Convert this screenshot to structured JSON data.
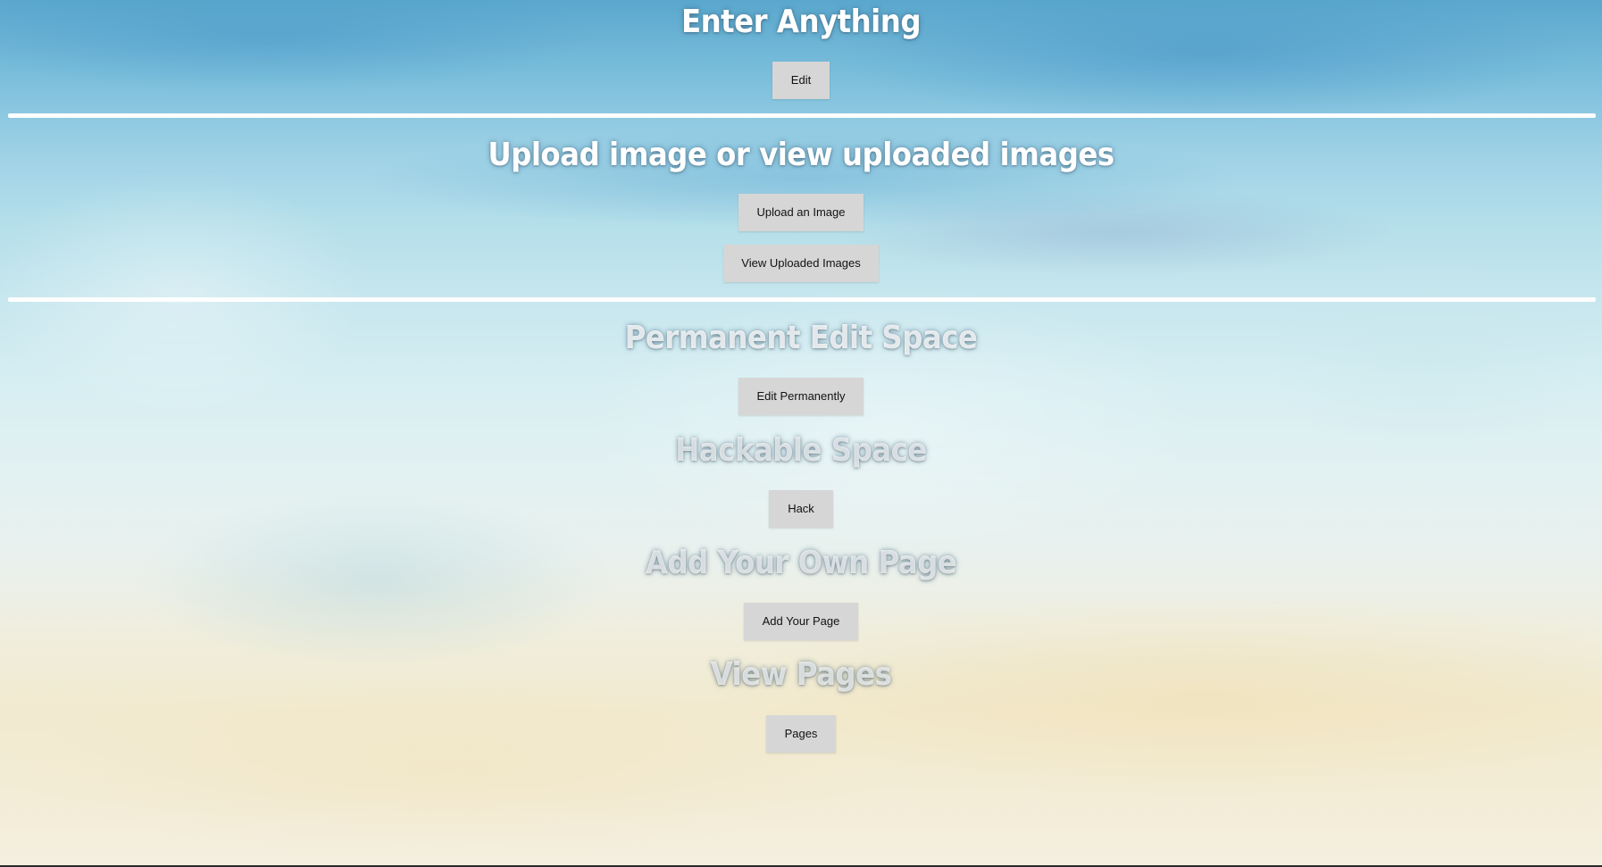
{
  "sections": {
    "enter_anything": {
      "title": "Enter Anything",
      "edit_button": "Edit"
    },
    "upload": {
      "title": "Upload image or view uploaded images",
      "upload_button": "Upload an Image",
      "view_button": "View Uploaded Images"
    },
    "permanent": {
      "title": "Permanent Edit Space",
      "edit_permanently_button": "Edit Permanently"
    },
    "hackable": {
      "title": "Hackable Space",
      "hack_button": "Hack"
    },
    "add_page": {
      "title": "Add Your Own Page",
      "add_button": "Add Your Page"
    },
    "view_pages": {
      "title": "View Pages",
      "pages_button": "Pages"
    }
  },
  "colors": {
    "button_background": "#d6d6d6",
    "button_text": "#111111",
    "title_text": "#ffffff",
    "divider": "#ffffff"
  }
}
